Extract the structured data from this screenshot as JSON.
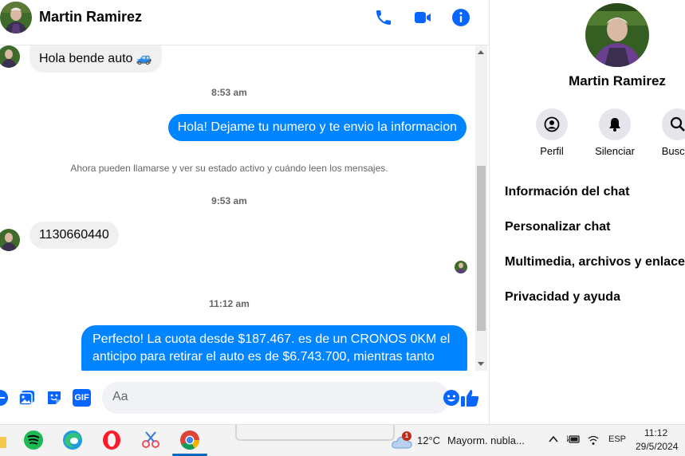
{
  "header": {
    "contact_name": "Martin Ramirez",
    "icons": [
      "phone-icon",
      "video-call-icon",
      "info-icon"
    ]
  },
  "messages": {
    "incoming_1": "Hola bende auto 🚙",
    "time_1": "8:53 am",
    "outgoing_1": "Hola! Dejame tu numero y te envio la informacion",
    "system_notice": "Ahora pueden llamarse y ver su estado activo y cuándo leen los mensajes.",
    "time_2": "9:53 am",
    "incoming_2": "1130660440",
    "time_3": "11:12 am",
    "outgoing_2": "Perfecto! La cuota desde $187.467. es de un CRONOS 0KM el anticipo para retirar el auto es de $6.743.700, mientras tanto"
  },
  "composer": {
    "placeholder": "Aa",
    "icons": [
      "add-icon",
      "image-icon",
      "sticker-icon",
      "gif-icon",
      "emoji-icon",
      "like-icon"
    ],
    "gif_label": "GIF"
  },
  "profile_panel": {
    "name": "Martin Ramirez",
    "actions": [
      {
        "label": "Perfil",
        "icon": "profile-icon"
      },
      {
        "label": "Silenciar",
        "icon": "bell-icon"
      },
      {
        "label": "Buscar",
        "icon": "search-icon"
      }
    ],
    "menu": [
      "Información del chat",
      "Personalizar chat",
      "Multimedia, archivos y enlaces",
      "Privacidad y ayuda"
    ]
  },
  "taskbar": {
    "weather_temp": "12°C",
    "weather_desc": "Mayorm. nubla...",
    "weather_badge": "1",
    "language": "ESP",
    "time": "11:12",
    "date": "29/5/2024"
  },
  "colors": {
    "messenger_blue": "#0084ff",
    "icon_blue": "#0866ff",
    "incoming_bubble": "#f0f0f0"
  }
}
